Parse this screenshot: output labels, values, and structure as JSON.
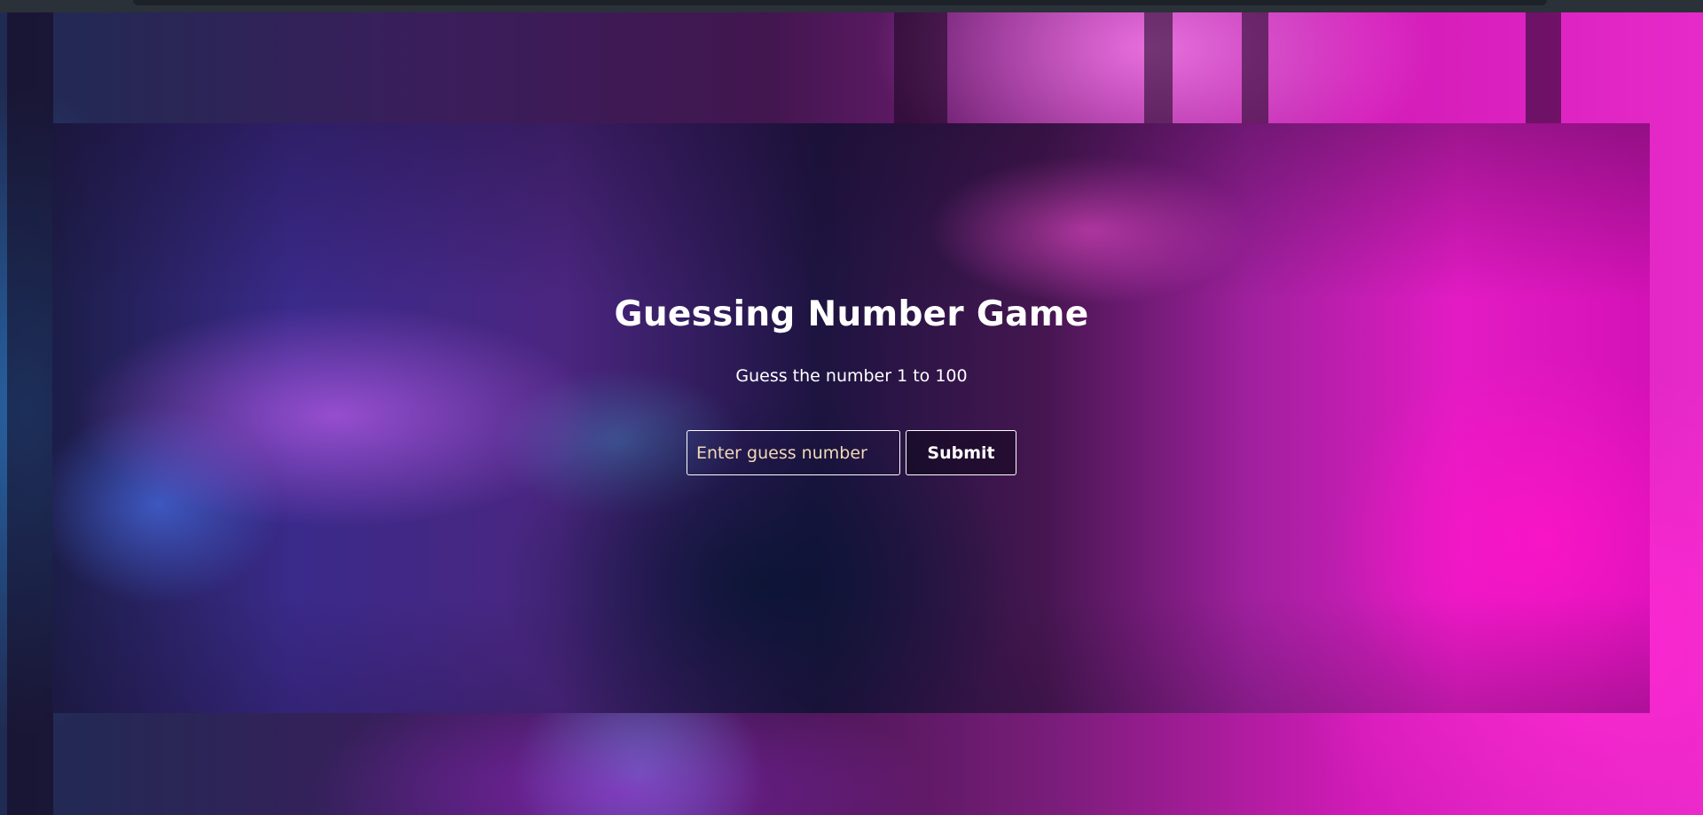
{
  "game": {
    "title": "Guessing Number Game",
    "subtitle": "Guess the number 1 to 100",
    "input_placeholder": "Enter guess number",
    "input_value": "",
    "submit_label": "Submit"
  },
  "colors": {
    "text": "#ffffff",
    "placeholder": "#f3d9b8",
    "border": "#ffffff",
    "accent_pink": "#e31bc4",
    "accent_blue": "#3a2a8a"
  }
}
